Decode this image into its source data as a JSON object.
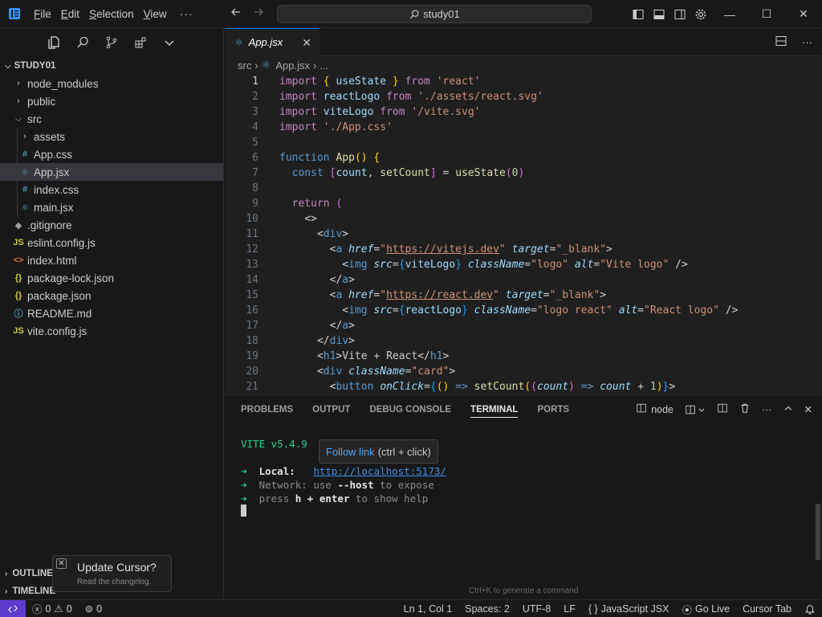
{
  "titlebar": {
    "menu": [
      "File",
      "Edit",
      "Selection",
      "View"
    ],
    "menu_underline": [
      "F",
      "E",
      "S",
      "V"
    ],
    "menu_rest": [
      "ile",
      "dit",
      "election",
      "iew"
    ],
    "more": "···",
    "search_text": "study01",
    "win_min": "—",
    "win_max": "☐",
    "win_close": "✕"
  },
  "sidebar": {
    "workspace": "STUDY01",
    "items": [
      {
        "label": "node_modules",
        "type": "folder",
        "expanded": false,
        "depth": 0
      },
      {
        "label": "public",
        "type": "folder",
        "expanded": false,
        "depth": 0
      },
      {
        "label": "src",
        "type": "folder",
        "expanded": true,
        "depth": 0
      },
      {
        "label": "assets",
        "type": "folder",
        "expanded": false,
        "depth": 1
      },
      {
        "label": "App.css",
        "type": "css",
        "icon": "#",
        "depth": 1
      },
      {
        "label": "App.jsx",
        "type": "react",
        "icon": "⚛",
        "depth": 1,
        "active": true
      },
      {
        "label": "index.css",
        "type": "css",
        "icon": "#",
        "depth": 1
      },
      {
        "label": "main.jsx",
        "type": "react",
        "icon": "⚛",
        "depth": 1
      },
      {
        "label": ".gitignore",
        "type": "git",
        "icon": "◆",
        "depth": 0
      },
      {
        "label": "eslint.config.js",
        "type": "js",
        "icon": "JS",
        "depth": 0
      },
      {
        "label": "index.html",
        "type": "html",
        "icon": "<>",
        "depth": 0
      },
      {
        "label": "package-lock.json",
        "type": "json",
        "icon": "{}",
        "depth": 0
      },
      {
        "label": "package.json",
        "type": "json",
        "icon": "{}",
        "depth": 0
      },
      {
        "label": "README.md",
        "type": "md",
        "icon": "ⓘ",
        "depth": 0
      },
      {
        "label": "vite.config.js",
        "type": "js",
        "icon": "JS",
        "depth": 0
      }
    ],
    "outline": "OUTLINE",
    "timeline": "TIMELINE"
  },
  "toast": {
    "title": "Update Cursor?",
    "subtitle": "Read the changelog."
  },
  "editor": {
    "tab_label": "App.jsx",
    "breadcrumb": {
      "folder": "src",
      "file": "App.jsx",
      "more": "..."
    }
  },
  "panel": {
    "tabs": [
      "PROBLEMS",
      "OUTPUT",
      "DEBUG CONSOLE",
      "TERMINAL",
      "PORTS"
    ],
    "active_tab": "TERMINAL",
    "terminal_name": "node",
    "vite_version": "VITE v5.4.9",
    "local_label": "Local:",
    "local_url": "http://localhost:5173/",
    "network_label": "Network:",
    "network_text_pre": "use ",
    "network_flag": "--host",
    "network_text_post": " to expose",
    "help_pre": "press ",
    "help_key": "h + enter",
    "help_post": " to show help",
    "tooltip_link": "Follow link",
    "tooltip_hint": "(ctrl + click)",
    "hint": "Ctrl+K to generate a command"
  },
  "statusbar": {
    "errors": "0",
    "warnings": "0",
    "ports": "0",
    "position": "Ln 1, Col 1",
    "spaces": "Spaces: 2",
    "encoding": "UTF-8",
    "eol": "LF",
    "language": "JavaScript JSX",
    "golive": "Go Live",
    "cursor_tab": "Cursor Tab"
  },
  "colors": {
    "accent": "#0078d4",
    "remote": "#5c3bcf",
    "terminal_green": "#23d18b",
    "link": "#3b8eea"
  }
}
